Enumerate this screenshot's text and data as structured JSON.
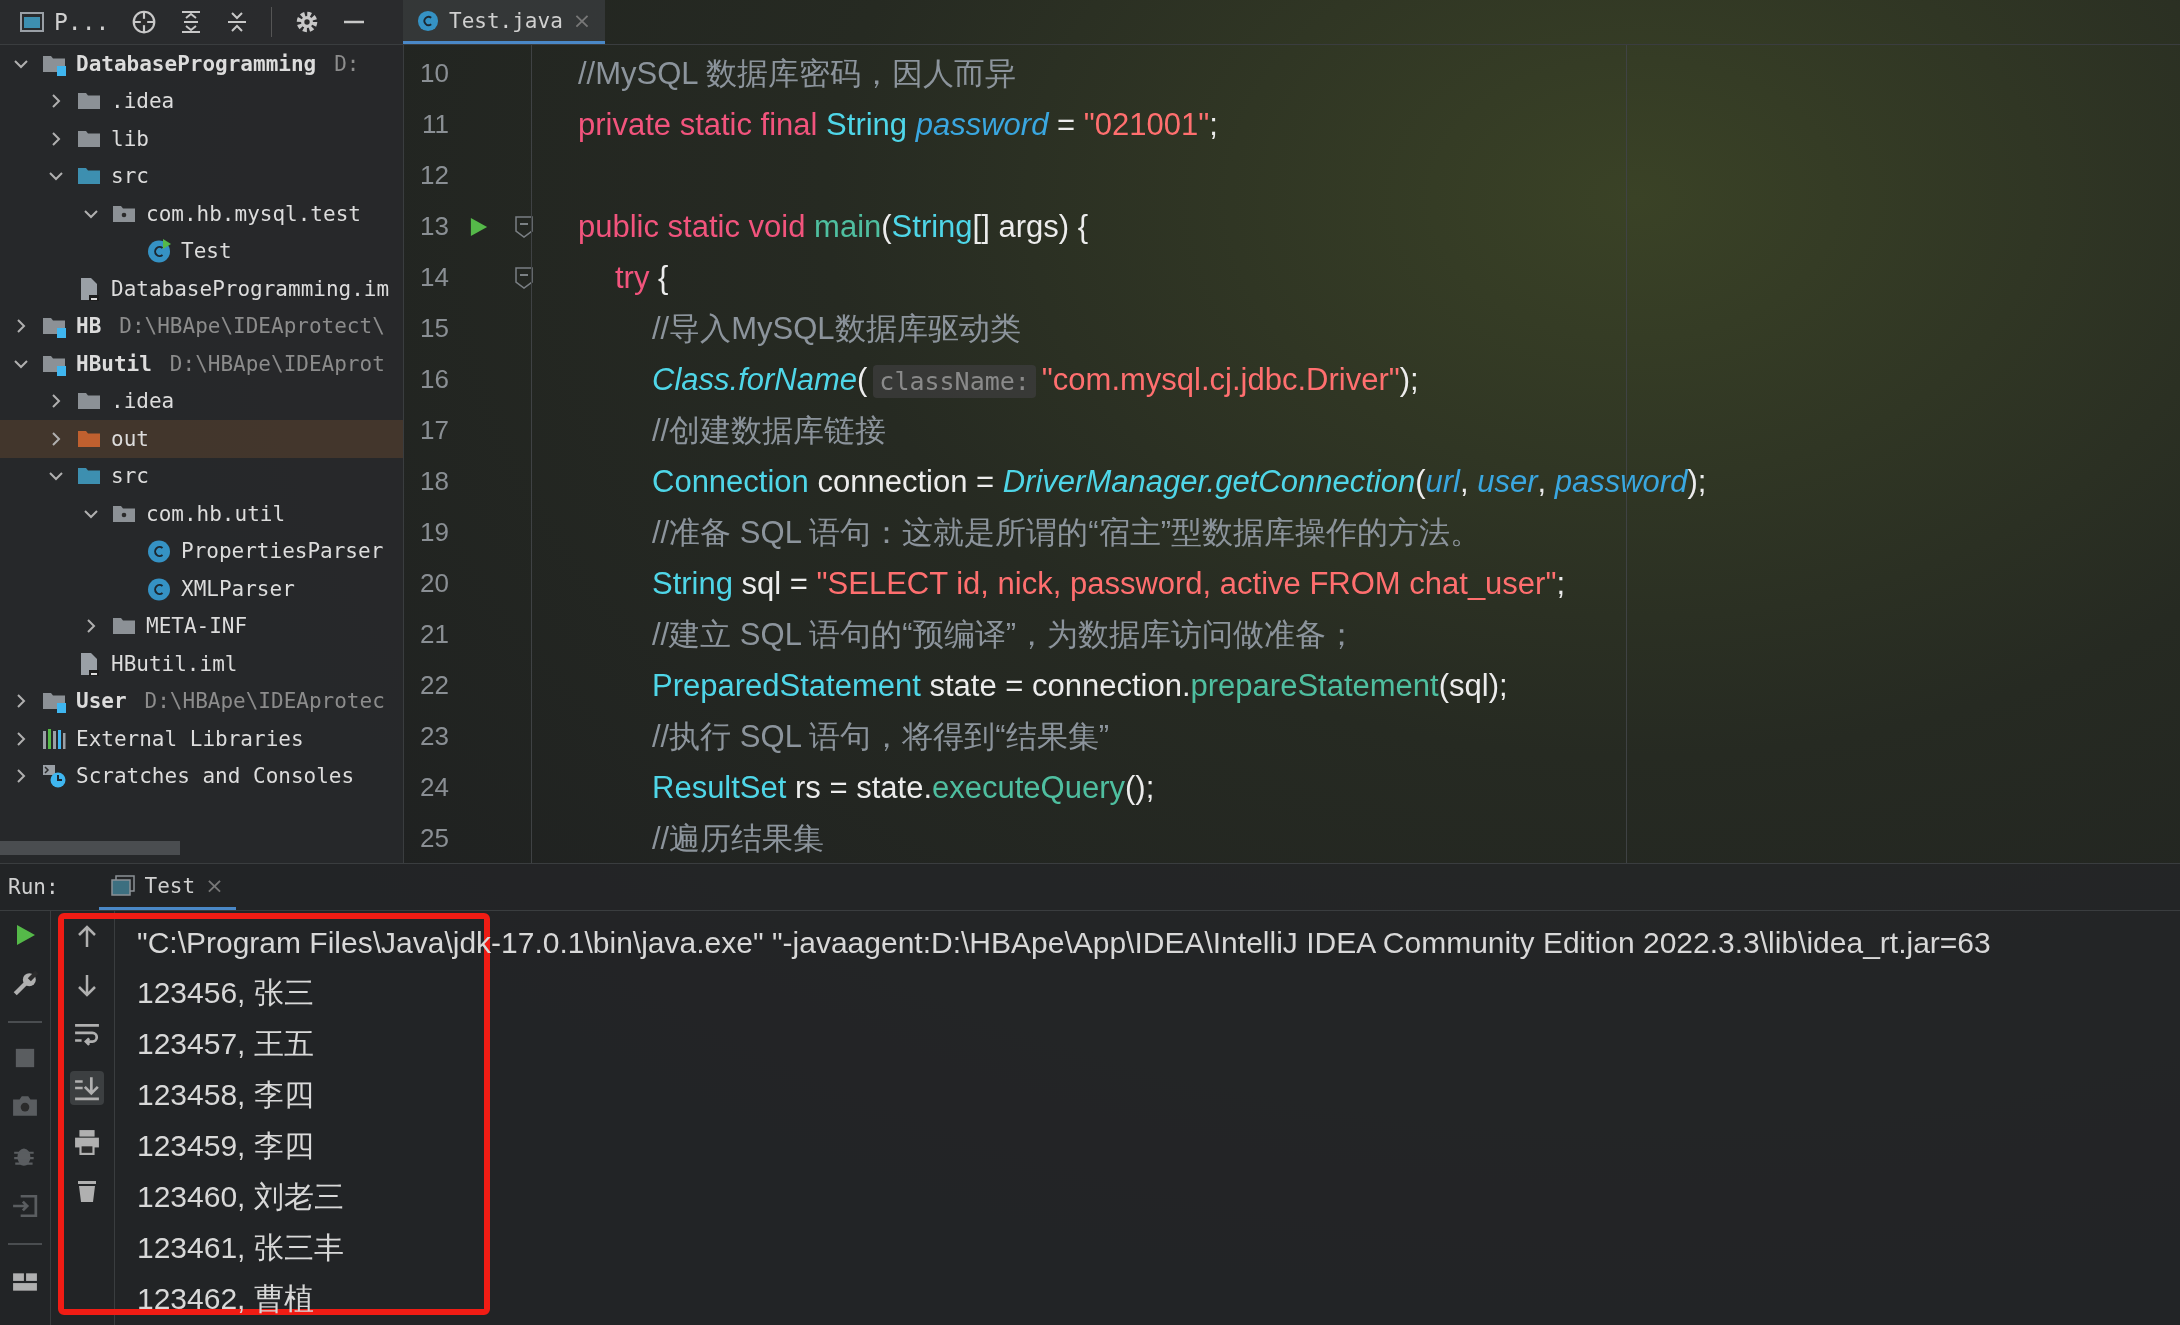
{
  "project_panel": {
    "title": "P...",
    "tree": [
      {
        "label": "DatabaseProgramming",
        "path": "D:",
        "kind": "module",
        "expanded": true,
        "selected": false,
        "children": [
          {
            "label": ".idea",
            "kind": "folder",
            "expanded": false,
            "selected": false
          },
          {
            "label": "lib",
            "kind": "folder",
            "expanded": false,
            "selected": false
          },
          {
            "label": "src",
            "kind": "source-folder",
            "expanded": true,
            "selected": false,
            "children": [
              {
                "label": "com.hb.mysql.test",
                "kind": "package",
                "expanded": true,
                "selected": false,
                "children": [
                  {
                    "label": "Test",
                    "kind": "runnable-class",
                    "selected": false
                  }
                ]
              }
            ]
          },
          {
            "label": "DatabaseProgramming.im",
            "kind": "iml",
            "selected": false
          }
        ]
      },
      {
        "label": "HB",
        "path": "D:\\HBApe\\IDEAprotect\\",
        "kind": "module",
        "expanded": false,
        "selected": false
      },
      {
        "label": "HButil",
        "path": "D:\\HBApe\\IDEAprot",
        "kind": "module",
        "expanded": true,
        "selected": false,
        "children": [
          {
            "label": ".idea",
            "kind": "folder",
            "expanded": false,
            "selected": false
          },
          {
            "label": "out",
            "kind": "excluded-folder",
            "expanded": false,
            "selected": true
          },
          {
            "label": "src",
            "kind": "source-folder",
            "expanded": true,
            "selected": false,
            "children": [
              {
                "label": "com.hb.util",
                "kind": "package",
                "expanded": true,
                "selected": false,
                "children": [
                  {
                    "label": "PropertiesParser",
                    "kind": "class",
                    "selected": false
                  },
                  {
                    "label": "XMLParser",
                    "kind": "class",
                    "selected": false
                  }
                ]
              },
              {
                "label": "META-INF",
                "kind": "folder",
                "expanded": false,
                "selected": false
              }
            ]
          },
          {
            "label": "HButil.iml",
            "kind": "iml",
            "selected": false
          }
        ]
      },
      {
        "label": "User",
        "path": "D:\\HBApe\\IDEAprotec",
        "kind": "module",
        "expanded": false,
        "selected": false
      },
      {
        "label": "External Libraries",
        "kind": "libraries",
        "expanded": false,
        "selected": false
      },
      {
        "label": "Scratches and Consoles",
        "kind": "scratches",
        "expanded": false,
        "selected": false
      }
    ]
  },
  "editor": {
    "tabs": [
      {
        "label": "Test.java",
        "close": "×",
        "selected": true
      }
    ],
    "lines": [
      {
        "number": "10",
        "run_marker": false,
        "fold_marker": false,
        "tokens": [
          {
            "kind": "comment",
            "text": "//MySQL 数据库密码，因人而异"
          }
        ]
      },
      {
        "number": "11",
        "run_marker": false,
        "fold_marker": false,
        "tokens": [
          {
            "kind": "kw",
            "text": "private static final "
          },
          {
            "kind": "type",
            "text": "String "
          },
          {
            "kind": "field",
            "text": "password"
          },
          {
            "kind": "plain",
            "text": " = "
          },
          {
            "kind": "str",
            "text": "\"021001\""
          },
          {
            "kind": "plain",
            "text": ";"
          }
        ]
      },
      {
        "number": "12",
        "run_marker": false,
        "fold_marker": false
      },
      {
        "number": "13",
        "run_marker": true,
        "fold_marker": true,
        "tokens": [
          {
            "kind": "kw",
            "text": "public static void "
          },
          {
            "kind": "method",
            "text": "main"
          },
          {
            "kind": "plain",
            "text": "("
          },
          {
            "kind": "type",
            "text": "String"
          },
          {
            "kind": "plain",
            "text": "[] args) {"
          }
        ],
        "children": [
          {
            "number": "14",
            "run_marker": false,
            "fold_marker": true,
            "tokens": [
              {
                "kind": "kw",
                "text": "try"
              },
              {
                "kind": "plain",
                "text": " {"
              }
            ],
            "children": [
              {
                "number": "15",
                "run_marker": false,
                "fold_marker": false,
                "tokens": [
                  {
                    "kind": "comment",
                    "text": "//导入MySQL数据库驱动类"
                  }
                ]
              },
              {
                "number": "16",
                "run_marker": false,
                "fold_marker": false,
                "tokens": [
                  {
                    "kind": "static",
                    "text": "Class.forName"
                  },
                  {
                    "kind": "plain",
                    "text": "("
                  },
                  {
                    "kind": "hint",
                    "text": "className:"
                  },
                  {
                    "kind": "str",
                    "text": "\"com.mysql.cj.jdbc.Driver\""
                  },
                  {
                    "kind": "plain",
                    "text": ");"
                  }
                ]
              },
              {
                "number": "17",
                "run_marker": false,
                "fold_marker": false,
                "tokens": [
                  {
                    "kind": "comment",
                    "text": "//创建数据库链接"
                  }
                ]
              },
              {
                "number": "18",
                "run_marker": false,
                "fold_marker": false,
                "tokens": [
                  {
                    "kind": "type",
                    "text": "Connection"
                  },
                  {
                    "kind": "plain",
                    "text": " connection = "
                  },
                  {
                    "kind": "static",
                    "text": "DriverManager.getConnection"
                  },
                  {
                    "kind": "plain",
                    "text": "("
                  },
                  {
                    "kind": "field",
                    "text": "url"
                  },
                  {
                    "kind": "plain",
                    "text": ", "
                  },
                  {
                    "kind": "field",
                    "text": "user"
                  },
                  {
                    "kind": "plain",
                    "text": ", "
                  },
                  {
                    "kind": "field",
                    "text": "password"
                  },
                  {
                    "kind": "plain",
                    "text": ");"
                  }
                ]
              },
              {
                "number": "19",
                "run_marker": false,
                "fold_marker": false,
                "tokens": [
                  {
                    "kind": "comment",
                    "text": "//准备 SQL 语句：这就是所谓的“宿主”型数据库操作的方法。"
                  }
                ]
              },
              {
                "number": "20",
                "run_marker": false,
                "fold_marker": false,
                "tokens": [
                  {
                    "kind": "type",
                    "text": "String"
                  },
                  {
                    "kind": "plain",
                    "text": " sql = "
                  },
                  {
                    "kind": "str",
                    "text": "\"SELECT id, nick, password, active FROM chat_user\""
                  },
                  {
                    "kind": "plain",
                    "text": ";"
                  }
                ]
              },
              {
                "number": "21",
                "run_marker": false,
                "fold_marker": false,
                "tokens": [
                  {
                    "kind": "comment",
                    "text": "//建立 SQL 语句的“预编译”，为数据库访问做准备；"
                  }
                ]
              },
              {
                "number": "22",
                "run_marker": false,
                "fold_marker": false,
                "tokens": [
                  {
                    "kind": "type",
                    "text": "PreparedStatement"
                  },
                  {
                    "kind": "plain",
                    "text": " state = connection."
                  },
                  {
                    "kind": "method",
                    "text": "prepareStatement"
                  },
                  {
                    "kind": "plain",
                    "text": "(sql);"
                  }
                ]
              },
              {
                "number": "23",
                "run_marker": false,
                "fold_marker": false,
                "tokens": [
                  {
                    "kind": "comment",
                    "text": "//执行 SQL 语句，将得到“结果集”"
                  }
                ]
              },
              {
                "number": "24",
                "run_marker": false,
                "fold_marker": false,
                "tokens": [
                  {
                    "kind": "type",
                    "text": "ResultSet"
                  },
                  {
                    "kind": "plain",
                    "text": " rs = state."
                  },
                  {
                    "kind": "method",
                    "text": "executeQuery"
                  },
                  {
                    "kind": "plain",
                    "text": "();"
                  }
                ]
              },
              {
                "number": "25",
                "run_marker": false,
                "fold_marker": false,
                "tokens": [
                  {
                    "kind": "comment",
                    "text": "//遍历结果集"
                  }
                ]
              }
            ]
          }
        ]
      }
    ]
  },
  "run_panel": {
    "label": "Run:",
    "tabs": [
      {
        "label": "Test",
        "close": "×",
        "selected": true
      }
    ],
    "scroll_to_end": true,
    "output": [
      "\"C:\\Program Files\\Java\\jdk-17.0.1\\bin\\java.exe\" \"-javaagent:D:\\HBApe\\App\\IDEA\\IntelliJ IDEA Community Edition 2022.3.3\\lib\\idea_rt.jar=63",
      "123456, 张三",
      "123457, 王五",
      "123458, 李四",
      "123459, 李四",
      "123460, 刘老三",
      "123461, 张三丰",
      "123462, 曹植"
    ],
    "highlighted": true
  }
}
